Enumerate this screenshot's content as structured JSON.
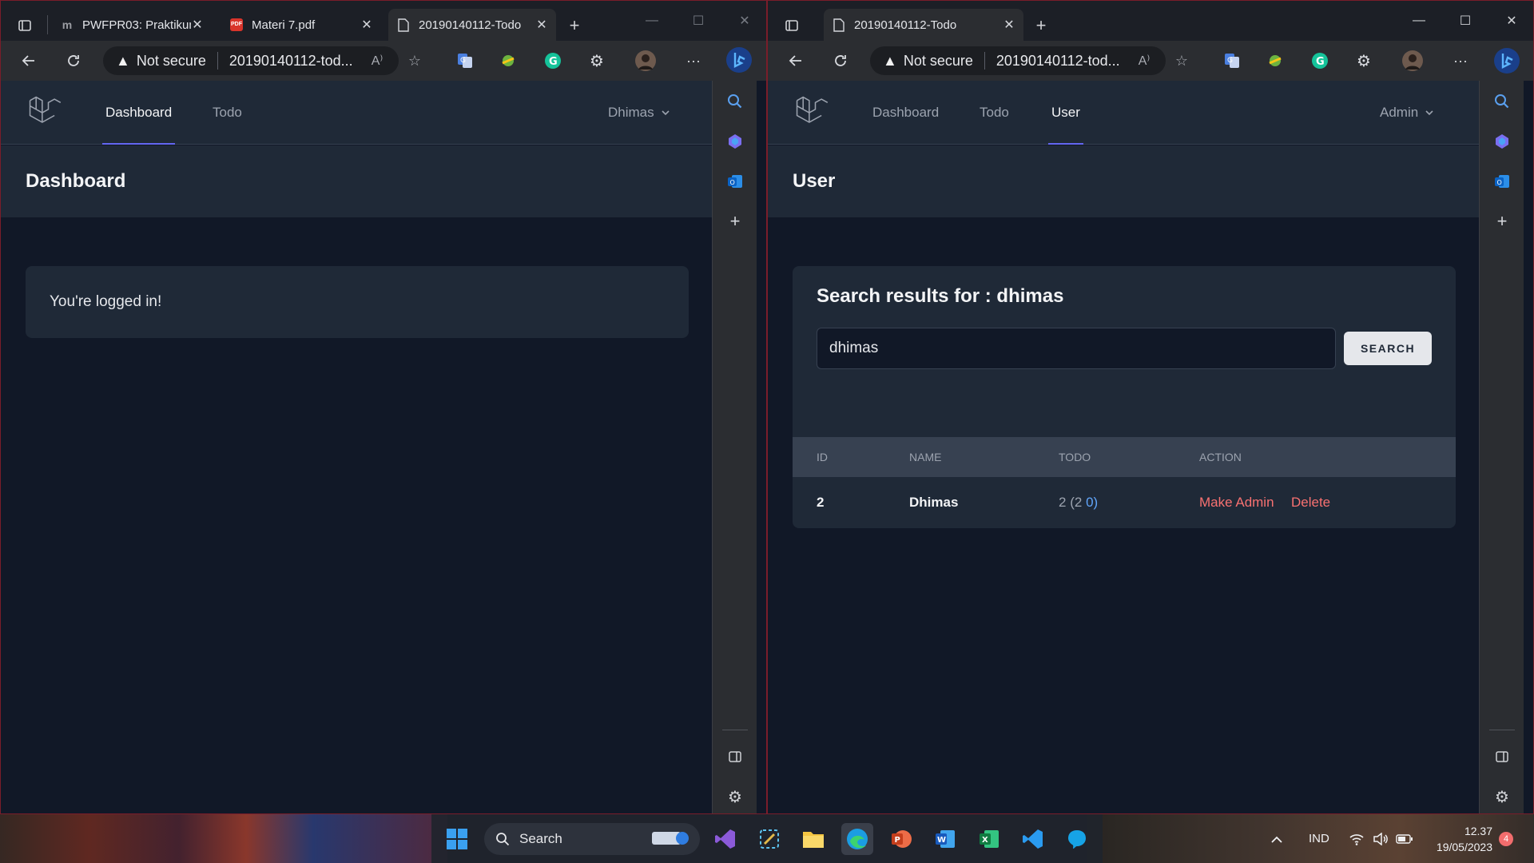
{
  "left_window": {
    "tabs": [
      {
        "title": "PWFPR03: Praktikum",
        "icon": "moodle-icon"
      },
      {
        "title": "Materi 7.pdf",
        "icon": "pdf-icon"
      },
      {
        "title": "20190140112-Todo",
        "icon": "page-icon",
        "active": true
      }
    ],
    "address": {
      "security": "Not secure",
      "url": "20190140112-tod..."
    },
    "nav": {
      "links": [
        "Dashboard",
        "Todo"
      ],
      "active": "Dashboard",
      "user": "Dhimas"
    },
    "header": {
      "title": "Dashboard"
    },
    "message": "You're logged in!"
  },
  "right_window": {
    "tabs": [
      {
        "title": "20190140112-Todo",
        "icon": "page-icon",
        "active": true
      }
    ],
    "address": {
      "security": "Not secure",
      "url": "20190140112-tod..."
    },
    "nav": {
      "links": [
        "Dashboard",
        "Todo",
        "User"
      ],
      "active": "User",
      "user": "Admin"
    },
    "header": {
      "title": "User"
    },
    "search": {
      "title": "Search results for : dhimas",
      "value": "dhimas",
      "button": "SEARCH"
    },
    "table": {
      "columns": [
        "ID",
        "NAME",
        "TODO",
        "ACTION"
      ],
      "rows": [
        {
          "id": "2",
          "name": "Dhimas",
          "todo_count": "2",
          "todo_open": "(2",
          "todo_done": "0)",
          "actions": [
            "Make Admin",
            "Delete"
          ]
        }
      ]
    }
  },
  "taskbar": {
    "search_label": "Search",
    "language": "IND",
    "time": "12.37",
    "date": "19/05/2023",
    "notification_count": "4"
  },
  "colors": {
    "accent": "#6366f1",
    "danger": "#f87171",
    "link": "#60a5fa",
    "page_bg": "#111827",
    "panel_bg": "#1f2937"
  }
}
